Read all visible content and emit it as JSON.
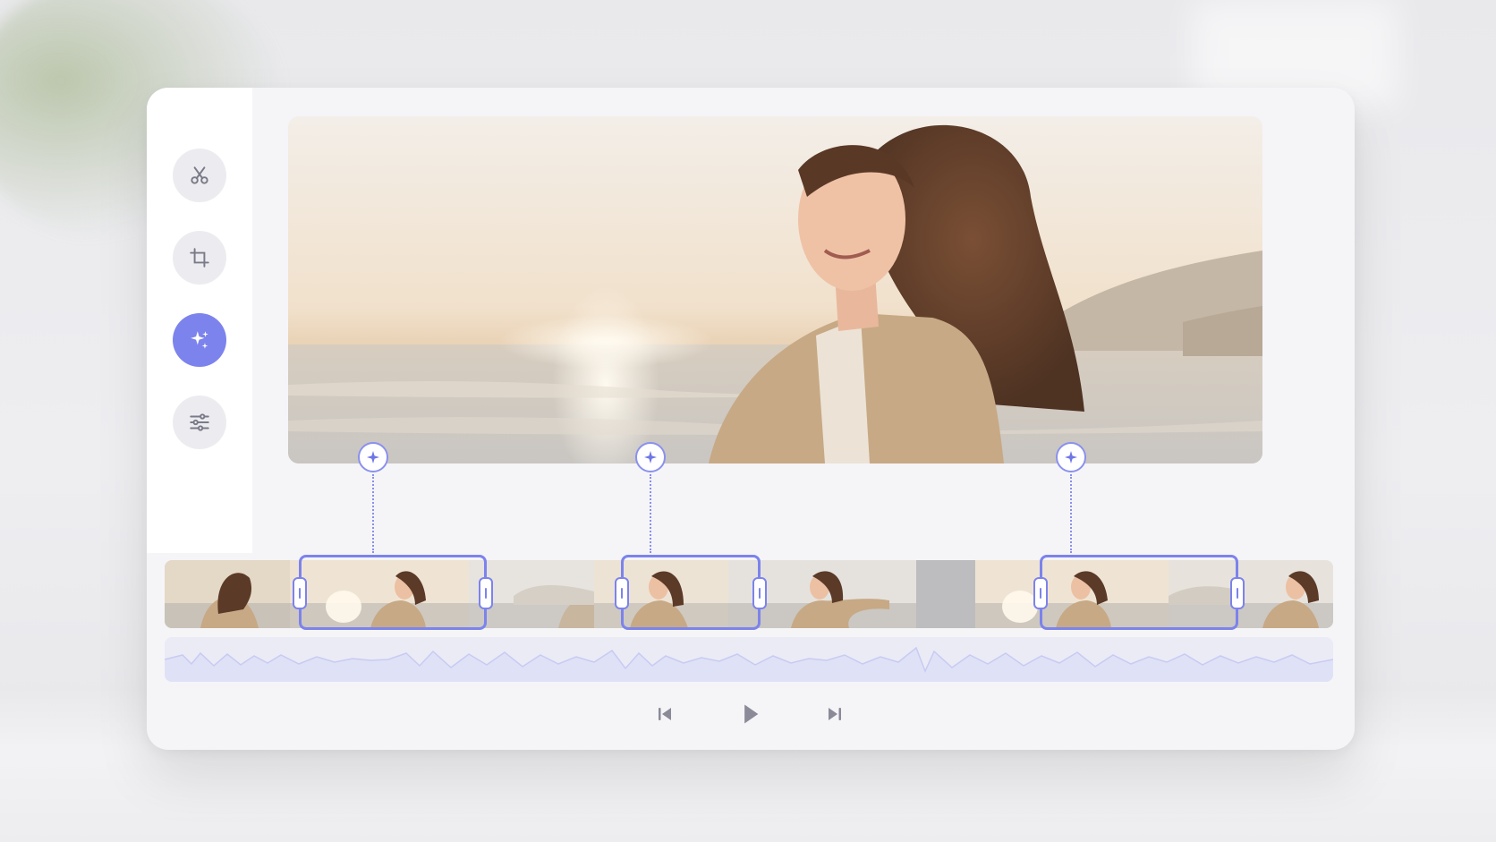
{
  "colors": {
    "accent": "#7c83ec",
    "icon_gray": "#7a7a88",
    "panel": "#f5f5f8",
    "waveform": "#d6d8f6"
  },
  "sidebar": {
    "tools": [
      {
        "icon": "scissors-icon",
        "active": false
      },
      {
        "icon": "crop-icon",
        "active": false
      },
      {
        "icon": "sparkle-icon",
        "active": true
      },
      {
        "icon": "sliders-icon",
        "active": false
      }
    ]
  },
  "timeline": {
    "ai_markers": 3,
    "selected_clips": 3
  },
  "playback": {
    "controls": [
      "skip-back-icon",
      "play-icon",
      "skip-forward-icon"
    ]
  }
}
